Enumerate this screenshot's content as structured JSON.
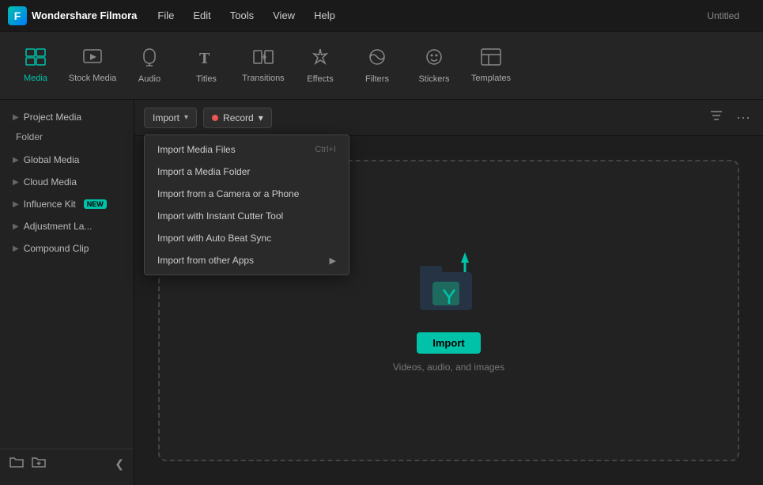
{
  "app": {
    "logo_text": "Wondershare Filmora",
    "window_title": "Untitled"
  },
  "menubar": {
    "items": [
      "File",
      "Edit",
      "Tools",
      "View",
      "Help"
    ]
  },
  "toolbar": {
    "buttons": [
      {
        "id": "media",
        "icon": "▦",
        "label": "Media",
        "active": true
      },
      {
        "id": "stock-media",
        "icon": "🎬",
        "label": "Stock Media",
        "active": false
      },
      {
        "id": "audio",
        "icon": "♪",
        "label": "Audio",
        "active": false
      },
      {
        "id": "titles",
        "icon": "T",
        "label": "Titles",
        "active": false
      },
      {
        "id": "transitions",
        "icon": "⇄",
        "label": "Transitions",
        "active": false
      },
      {
        "id": "effects",
        "icon": "✦",
        "label": "Effects",
        "active": false
      },
      {
        "id": "filters",
        "icon": "◈",
        "label": "Filters",
        "active": false
      },
      {
        "id": "stickers",
        "icon": "☺",
        "label": "Stickers",
        "active": false
      },
      {
        "id": "templates",
        "icon": "▭",
        "label": "Templates",
        "active": false
      }
    ]
  },
  "sidebar": {
    "sections": [
      {
        "id": "project-media",
        "label": "Project Media",
        "has_arrow": true,
        "badge": null
      },
      {
        "id": "folder",
        "label": "Folder",
        "is_folder": true
      },
      {
        "id": "global-media",
        "label": "Global Media",
        "has_arrow": true,
        "badge": null
      },
      {
        "id": "cloud-media",
        "label": "Cloud Media",
        "has_arrow": true,
        "badge": null
      },
      {
        "id": "influence-kit",
        "label": "Influence Kit",
        "has_arrow": true,
        "badge": "NEW"
      },
      {
        "id": "adjustment-layer",
        "label": "Adjustment La...",
        "has_arrow": true,
        "badge": null
      },
      {
        "id": "compound-clip",
        "label": "Compound Clip",
        "has_arrow": true,
        "badge": null
      }
    ],
    "footer": {
      "new_folder_icon": "📁",
      "add_icon": "📂",
      "collapse_icon": "❮"
    }
  },
  "content_toolbar": {
    "import_label": "Import",
    "record_label": "Record",
    "import_dropdown_arrow": "▾",
    "record_dropdown_arrow": "▾"
  },
  "import_menu": {
    "items": [
      {
        "id": "import-media-files",
        "label": "Import Media Files",
        "shortcut": "Ctrl+I",
        "has_sub": false
      },
      {
        "id": "import-media-folder",
        "label": "Import a Media Folder",
        "shortcut": "",
        "has_sub": false
      },
      {
        "id": "import-camera-phone",
        "label": "Import from a Camera or a Phone",
        "shortcut": "",
        "has_sub": false
      },
      {
        "id": "import-instant-cutter",
        "label": "Import with Instant Cutter Tool",
        "shortcut": "",
        "has_sub": false
      },
      {
        "id": "import-auto-beat-sync",
        "label": "Import with Auto Beat Sync",
        "shortcut": "",
        "has_sub": false
      },
      {
        "id": "import-other-apps",
        "label": "Import from other Apps",
        "shortcut": "",
        "has_sub": true
      }
    ]
  },
  "dropzone": {
    "import_button_label": "Import",
    "description_text": "Videos, audio, and images"
  }
}
